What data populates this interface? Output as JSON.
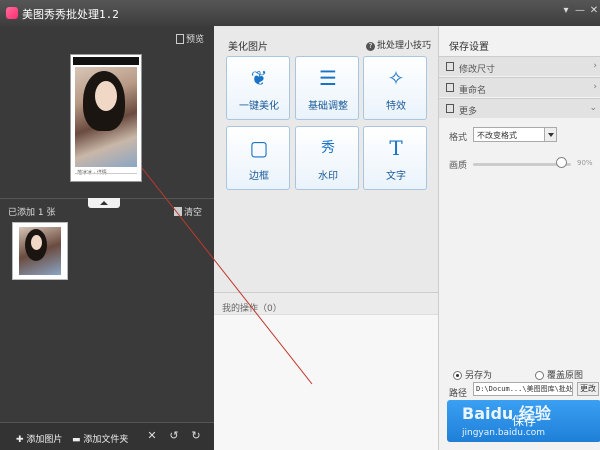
{
  "window": {
    "title": "美图秀秀批处理1.2",
    "controls": [
      "▾",
      "—",
      "✕"
    ]
  },
  "left": {
    "preview_label": "预览",
    "preview_caption": "范冰冰 · 详情",
    "added_count": "已添加 1 张",
    "clear_label": "清空",
    "bottom": {
      "add_image": "添加图片",
      "add_folder": "添加文件夹",
      "delete_icon": "✕",
      "rotate_left_icon": "↺",
      "rotate_right_icon": "↻"
    }
  },
  "middle": {
    "title": "美化图片",
    "tips": "批处理小技巧",
    "tiles": [
      {
        "label": "一键美化",
        "icon": "tulip-icon",
        "glyph": "❦"
      },
      {
        "label": "基础调整",
        "icon": "sliders-icon",
        "glyph": "☰"
      },
      {
        "label": "特效",
        "icon": "magic-wand-icon",
        "glyph": "✧"
      },
      {
        "label": "边框",
        "icon": "frame-icon",
        "glyph": "▢"
      },
      {
        "label": "水印",
        "icon": "watermark-icon",
        "glyph": "秀"
      },
      {
        "label": "文字",
        "icon": "text-icon",
        "glyph": "T"
      }
    ],
    "ops_label": "我的操作（0）"
  },
  "right": {
    "title": "保存设置",
    "sections": [
      "修改尺寸",
      "重命名",
      "更多"
    ],
    "format_label": "格式",
    "format_value": "不改变格式",
    "quality_label": "画质",
    "quality_value": "90%",
    "quality_level": 0.9,
    "save_as_label": "另存为",
    "overwrite_label": "覆盖原图",
    "path_label": "路径",
    "path_value": "D:\\Docum...\\美图图库\\批处",
    "change_label": "更改",
    "save_label": "保存"
  },
  "watermark": {
    "logo": "Baidu 经验",
    "url": "jingyan.baidu.com"
  },
  "colors": {
    "accent": "#1f7fd8",
    "annotation_line": "#c0392b"
  }
}
